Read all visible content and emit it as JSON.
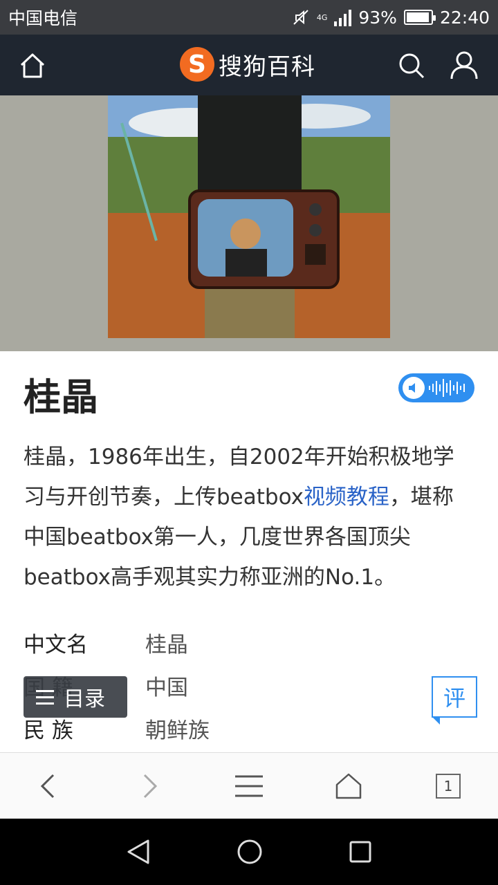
{
  "status_bar": {
    "carrier": "中国电信",
    "network": "4G",
    "battery": "93%",
    "battery_level": 0.93,
    "time": "22:40"
  },
  "header": {
    "brand_logo": "S",
    "brand_name": "搜狗百科"
  },
  "article": {
    "title": "桂晶",
    "summary": {
      "part1": "桂晶，1986年出生，自2002年开始积极地学习与开创节奏，上传beatbox",
      "link": "视频教程",
      "part2": "，堪称中国beatbox第一人，几度世界各国顶尖beatbox高手观其实力称亚洲的No.1。"
    },
    "infobox": [
      {
        "key": "中文名",
        "value": "桂晶"
      },
      {
        "key": "国 籍",
        "value": "中国"
      },
      {
        "key": "民 族",
        "value": "朝鲜族"
      }
    ]
  },
  "floating": {
    "toc_label": "目录",
    "comment_label": "评"
  },
  "browser_bar": {
    "tab_count": "1"
  },
  "colors": {
    "header_bg": "#1f2630",
    "accent": "#2f8ff0",
    "brand": "#f26b21",
    "link": "#2a63c7"
  }
}
